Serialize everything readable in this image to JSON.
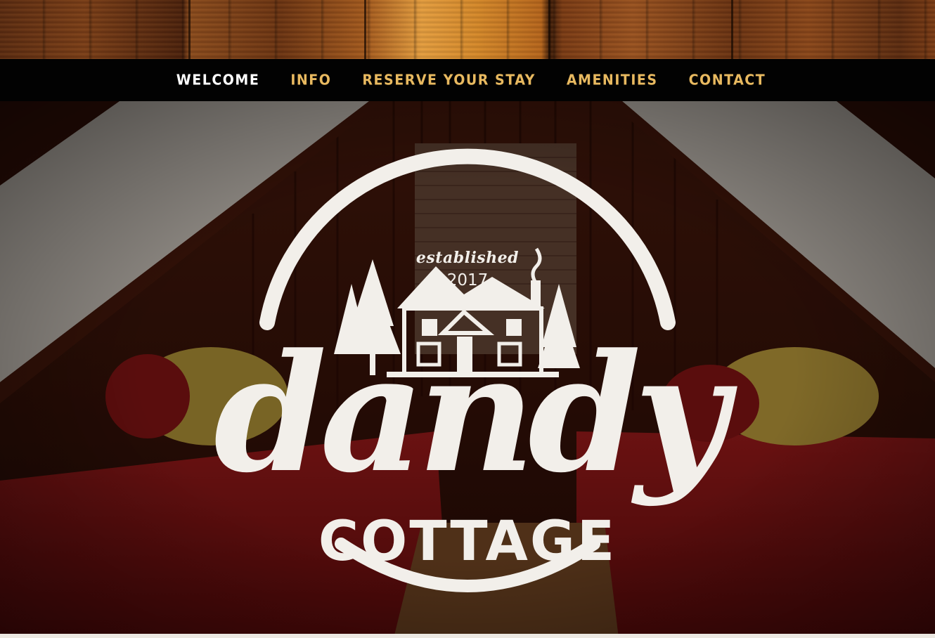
{
  "nav": {
    "items": [
      {
        "label": "WELCOME",
        "active": true
      },
      {
        "label": "INFO",
        "active": false
      },
      {
        "label": "RESERVE YOUR STAY",
        "active": false
      },
      {
        "label": "AMENITIES",
        "active": false
      },
      {
        "label": "CONTACT",
        "active": false
      }
    ]
  },
  "logo": {
    "established": "established",
    "year": "2017",
    "name": "dandy",
    "subtitle": "COTTAGE"
  },
  "colors": {
    "nav_background": "#020202",
    "nav_link": "#e8b960",
    "nav_active": "#ffffff",
    "logo": "#f2efea"
  }
}
